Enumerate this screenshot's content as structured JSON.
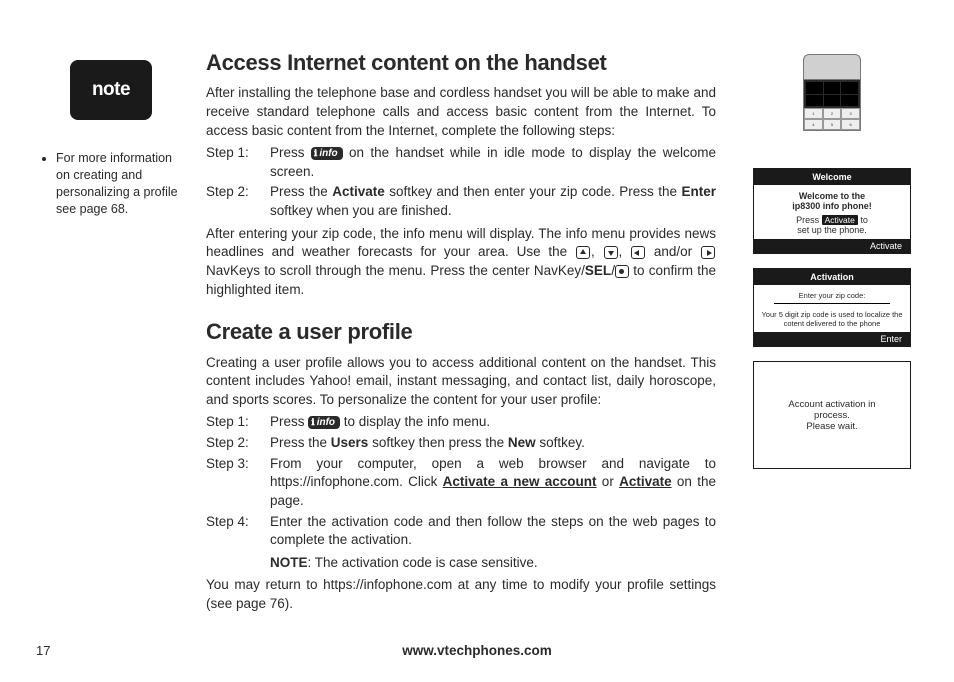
{
  "page_number": "17",
  "footer_url": "www.vtechphones.com",
  "note": {
    "badge_label": "note",
    "bullet": "For more information on creating and personalizing a profile see page 68."
  },
  "section1": {
    "heading": "Access Internet content on the handset",
    "intro": "After installing the telephone base and cordless handset you will be able to make and receive standard telephone calls and access basic content from the Internet. To access basic content from the Internet, complete the following steps:",
    "step1_label": "Step 1:",
    "step1_a": "Press ",
    "step1_b": " on the handset while in idle mode to display the welcome screen.",
    "step2_label": "Step 2:",
    "step2_a": "Press the ",
    "step2_activate": "Activate",
    "step2_b": " softkey and then enter your zip code. Press the ",
    "step2_enter": "Enter",
    "step2_c": " softkey when you are finished.",
    "post_a": "After entering your zip code, the info menu will display. The info menu provides news headlines and weather forecasts for your area. Use the ",
    "post_b": " and/or ",
    "post_c": " NavKeys to scroll through the menu. Press the center NavKey/",
    "post_sel": "SEL",
    "post_d": "/",
    "post_e": " to confirm the highlighted item."
  },
  "section2": {
    "heading": "Create a user profile",
    "intro": "Creating a user profile allows you to access additional content on the handset. This content includes Yahoo! email, instant messaging, and contact list, daily horoscope, and sports scores. To personalize the content for your user profile:",
    "step1_label": "Step 1:",
    "step1_a": "Press ",
    "step1_b": " to display the info menu.",
    "step2_label": "Step 2:",
    "step2_a": "Press the ",
    "step2_users": "Users",
    "step2_b": " softkey then press the ",
    "step2_new": "New",
    "step2_c": " softkey.",
    "step3_label": "Step 3:",
    "step3_a": "From your computer, open a web browser and navigate to https://infophone.com. Click ",
    "step3_link1": "Activate a new account",
    "step3_b": " or ",
    "step3_link2": "Activate",
    "step3_c": " on the page.",
    "step4_label": "Step 4:",
    "step4_a": "Enter the activation code and then follow the steps on the web pages to complete the activation.",
    "step4_note_lbl": "NOTE",
    "step4_note_txt": ": The activation code is case sensitive.",
    "outro": "You may return to https://infophone.com at any time to modify your profile settings (see page 76)."
  },
  "screens": {
    "s1": {
      "header": "Welcome",
      "line1": "Welcome to the",
      "line2": "ip8300 info phone!",
      "press": "Press",
      "activate_btn": "Activate",
      "to": "to",
      "setup": "set up the phone.",
      "footer": "Activate"
    },
    "s2": {
      "header": "Activation",
      "prompt": "Enter your zip code:",
      "tiny": "Your 5 digit zip code is used to localize the cotent delivered to the phone",
      "footer": "Enter"
    },
    "s3": {
      "line1": "Account activation in",
      "line2": "process.",
      "line3": "Please wait."
    }
  },
  "info_pill_label": "info"
}
